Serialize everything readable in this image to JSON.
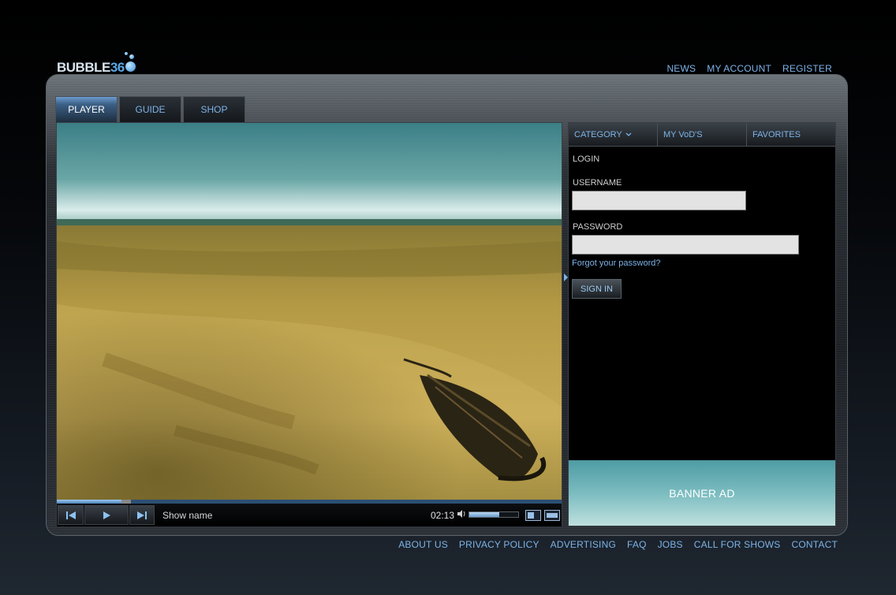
{
  "logo": {
    "text_main": "BUBBLE",
    "text_num": "36"
  },
  "top_nav": [
    {
      "label": "NEWS"
    },
    {
      "label": "MY ACCOUNT"
    },
    {
      "label": "REGISTER"
    }
  ],
  "main_tabs": [
    {
      "label": "PLAYER",
      "active": true
    },
    {
      "label": "GUIDE",
      "active": false
    },
    {
      "label": "SHOP",
      "active": false
    }
  ],
  "player": {
    "show_name": "Show name",
    "time": "02:13",
    "progress": 0.13,
    "volume": 0.62
  },
  "side_tabs": [
    {
      "label": "CATEGORY",
      "icon": "chevron-down-icon"
    },
    {
      "label": "MY VoD'S"
    },
    {
      "label": "FAVORITES"
    }
  ],
  "login": {
    "title": "LOGIN",
    "username_label": "USERNAME",
    "username_value": "",
    "password_label": "PASSWORD",
    "password_value": "",
    "forgot_label": "Forgot your password?",
    "signin_label": "SIGN IN"
  },
  "banner": {
    "label": "BANNER AD"
  },
  "footer_nav": [
    {
      "label": "ABOUT US"
    },
    {
      "label": "PRIVACY POLICY"
    },
    {
      "label": "ADVERTISING"
    },
    {
      "label": "FAQ"
    },
    {
      "label": "JOBS"
    },
    {
      "label": "CALL FOR SHOWS"
    },
    {
      "label": "CONTACT"
    }
  ],
  "colors": {
    "accent": "#7db3e8",
    "background": "#000000",
    "banner": "#7bbcc0"
  }
}
